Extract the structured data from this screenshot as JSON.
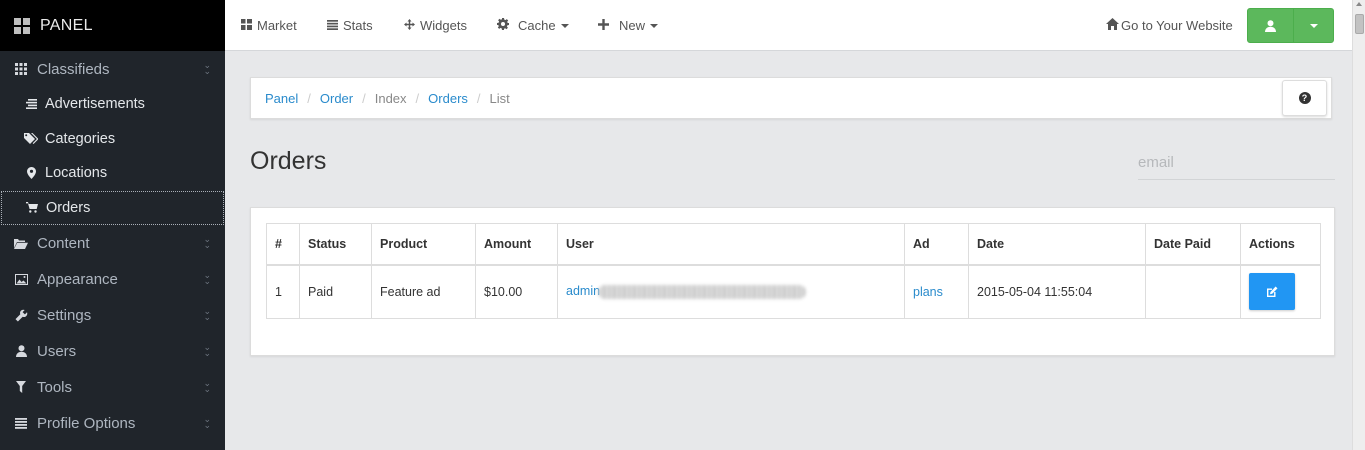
{
  "sidebar": {
    "brand": "PANEL",
    "sections": [
      {
        "label": "Classifieds",
        "icon": "grid-icon"
      },
      {
        "label": "Content",
        "icon": "folder-open-icon"
      },
      {
        "label": "Appearance",
        "icon": "picture-icon"
      },
      {
        "label": "Settings",
        "icon": "wrench-icon"
      },
      {
        "label": "Users",
        "icon": "user-icon"
      },
      {
        "label": "Tools",
        "icon": "filter-icon"
      },
      {
        "label": "Profile Options",
        "icon": "list-icon"
      }
    ],
    "classifieds_items": [
      {
        "label": "Advertisements",
        "icon": "list-alt-icon"
      },
      {
        "label": "Categories",
        "icon": "tags-icon"
      },
      {
        "label": "Locations",
        "icon": "map-marker-icon"
      },
      {
        "label": "Orders",
        "icon": "shopping-cart-icon",
        "active": true
      }
    ]
  },
  "topbar": {
    "market": "Market",
    "stats": "Stats",
    "widgets": "Widgets",
    "cache": "Cache",
    "new": "New",
    "go_to_website": "Go to Your Website"
  },
  "breadcrumb": {
    "panel": "Panel",
    "order": "Order",
    "index": "Index",
    "orders": "Orders",
    "list": "List"
  },
  "main": {
    "title": "Orders",
    "email_placeholder": "email"
  },
  "table": {
    "headers": [
      "#",
      "Status",
      "Product",
      "Amount",
      "User",
      "Ad",
      "Date",
      "Date Paid",
      "Actions"
    ],
    "rows": [
      {
        "num": "1",
        "status": "Paid",
        "product": "Feature ad",
        "amount": "$10.00",
        "user": "admin",
        "ad": "plans",
        "date": "2015-05-04 11:55:04",
        "date_paid": ""
      }
    ]
  },
  "colors": {
    "accent_green": "#5cb85c",
    "link_blue": "#2a8bcc",
    "action_blue": "#2196f3",
    "sidebar_bg": "#20252b"
  }
}
